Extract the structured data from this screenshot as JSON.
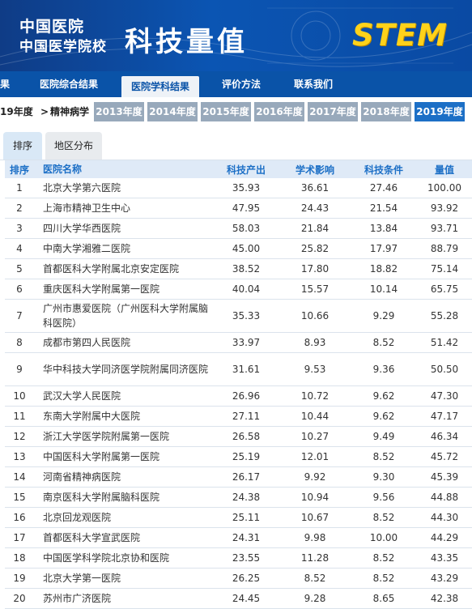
{
  "banner": {
    "logo_line1": "中国医院",
    "logo_line2": "中国医学院校",
    "title": "科技量值",
    "stem_logo": "STEM"
  },
  "nav": {
    "items": [
      "果",
      "医院综合结果",
      "医院学科结果",
      "评价方法",
      "联系我们"
    ],
    "active_index": 2
  },
  "breadcrumb": {
    "year": "19年度",
    "separator": ">",
    "subject": "精神病学"
  },
  "years": {
    "items": [
      "2013年度",
      "2014年度",
      "2015年度",
      "2016年度",
      "2017年度",
      "2018年度",
      "2019年度"
    ],
    "active_index": 6
  },
  "tabs": {
    "items": [
      "排序",
      "地区分布"
    ],
    "active_index": 0
  },
  "table": {
    "headers": [
      "排序",
      "医院名称",
      "科技产出",
      "学术影响",
      "科技条件",
      "量值"
    ],
    "rows": [
      {
        "rank": "1",
        "name": "北京大学第六医院",
        "output": "35.93",
        "impact": "36.61",
        "condition": "27.46",
        "value": "100.00"
      },
      {
        "rank": "2",
        "name": "上海市精神卫生中心",
        "output": "47.95",
        "impact": "24.43",
        "condition": "21.54",
        "value": "93.92"
      },
      {
        "rank": "3",
        "name": "四川大学华西医院",
        "output": "58.03",
        "impact": "21.84",
        "condition": "13.84",
        "value": "93.71"
      },
      {
        "rank": "4",
        "name": "中南大学湘雅二医院",
        "output": "45.00",
        "impact": "25.82",
        "condition": "17.97",
        "value": "88.79"
      },
      {
        "rank": "5",
        "name": "首都医科大学附属北京安定医院",
        "output": "38.52",
        "impact": "17.80",
        "condition": "18.82",
        "value": "75.14"
      },
      {
        "rank": "6",
        "name": "重庆医科大学附属第一医院",
        "output": "40.04",
        "impact": "15.57",
        "condition": "10.14",
        "value": "65.75"
      },
      {
        "rank": "7",
        "name": "广州市惠爱医院（广州医科大学附属脑科医院）",
        "output": "35.33",
        "impact": "10.66",
        "condition": "9.29",
        "value": "55.28"
      },
      {
        "rank": "8",
        "name": "成都市第四人民医院",
        "output": "33.97",
        "impact": "8.93",
        "condition": "8.52",
        "value": "51.42"
      },
      {
        "rank": "9",
        "name": "华中科技大学同济医学院附属同济医院",
        "output": "31.61",
        "impact": "9.53",
        "condition": "9.36",
        "value": "50.50"
      },
      {
        "rank": "10",
        "name": "武汉大学人民医院",
        "output": "26.96",
        "impact": "10.72",
        "condition": "9.62",
        "value": "47.30"
      },
      {
        "rank": "11",
        "name": "东南大学附属中大医院",
        "output": "27.11",
        "impact": "10.44",
        "condition": "9.62",
        "value": "47.17"
      },
      {
        "rank": "12",
        "name": "浙江大学医学院附属第一医院",
        "output": "26.58",
        "impact": "10.27",
        "condition": "9.49",
        "value": "46.34"
      },
      {
        "rank": "13",
        "name": "中国医科大学附属第一医院",
        "output": "25.19",
        "impact": "12.01",
        "condition": "8.52",
        "value": "45.72"
      },
      {
        "rank": "14",
        "name": "河南省精神病医院",
        "output": "26.17",
        "impact": "9.92",
        "condition": "9.30",
        "value": "45.39"
      },
      {
        "rank": "15",
        "name": "南京医科大学附属脑科医院",
        "output": "24.38",
        "impact": "10.94",
        "condition": "9.56",
        "value": "44.88"
      },
      {
        "rank": "16",
        "name": "北京回龙观医院",
        "output": "25.11",
        "impact": "10.67",
        "condition": "8.52",
        "value": "44.30"
      },
      {
        "rank": "17",
        "name": "首都医科大学宣武医院",
        "output": "24.31",
        "impact": "9.98",
        "condition": "10.00",
        "value": "44.29"
      },
      {
        "rank": "18",
        "name": "中国医学科学院北京协和医院",
        "output": "23.55",
        "impact": "11.28",
        "condition": "8.52",
        "value": "43.35"
      },
      {
        "rank": "19",
        "name": "北京大学第一医院",
        "output": "26.25",
        "impact": "8.52",
        "condition": "8.52",
        "value": "43.29"
      },
      {
        "rank": "20",
        "name": "苏州市广济医院",
        "output": "24.45",
        "impact": "9.28",
        "condition": "8.65",
        "value": "42.38"
      }
    ]
  }
}
